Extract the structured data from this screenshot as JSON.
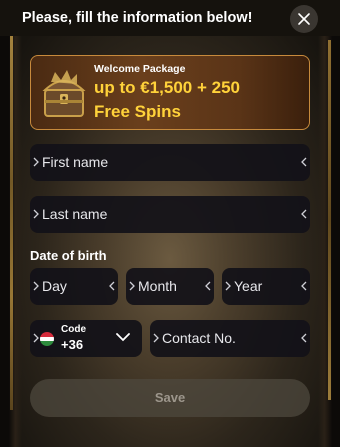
{
  "header": {
    "title": "Please, fill the information below!",
    "close_icon": "close-icon"
  },
  "promo": {
    "subtitle": "Welcome Package",
    "line1": "up to €1,500 + 250",
    "line2": "Free Spins",
    "accent_color": "#ffd23a",
    "icon": "treasure-chest-icon"
  },
  "form": {
    "first_name_placeholder": "First name",
    "last_name_placeholder": "Last name",
    "dob_label": "Date of birth",
    "day_placeholder": "Day",
    "month_placeholder": "Month",
    "year_placeholder": "Year",
    "code_label": "Code",
    "code_value": "+36",
    "code_flag": "hungary-flag-icon",
    "contact_placeholder": "Contact No.",
    "save_label": "Save"
  }
}
